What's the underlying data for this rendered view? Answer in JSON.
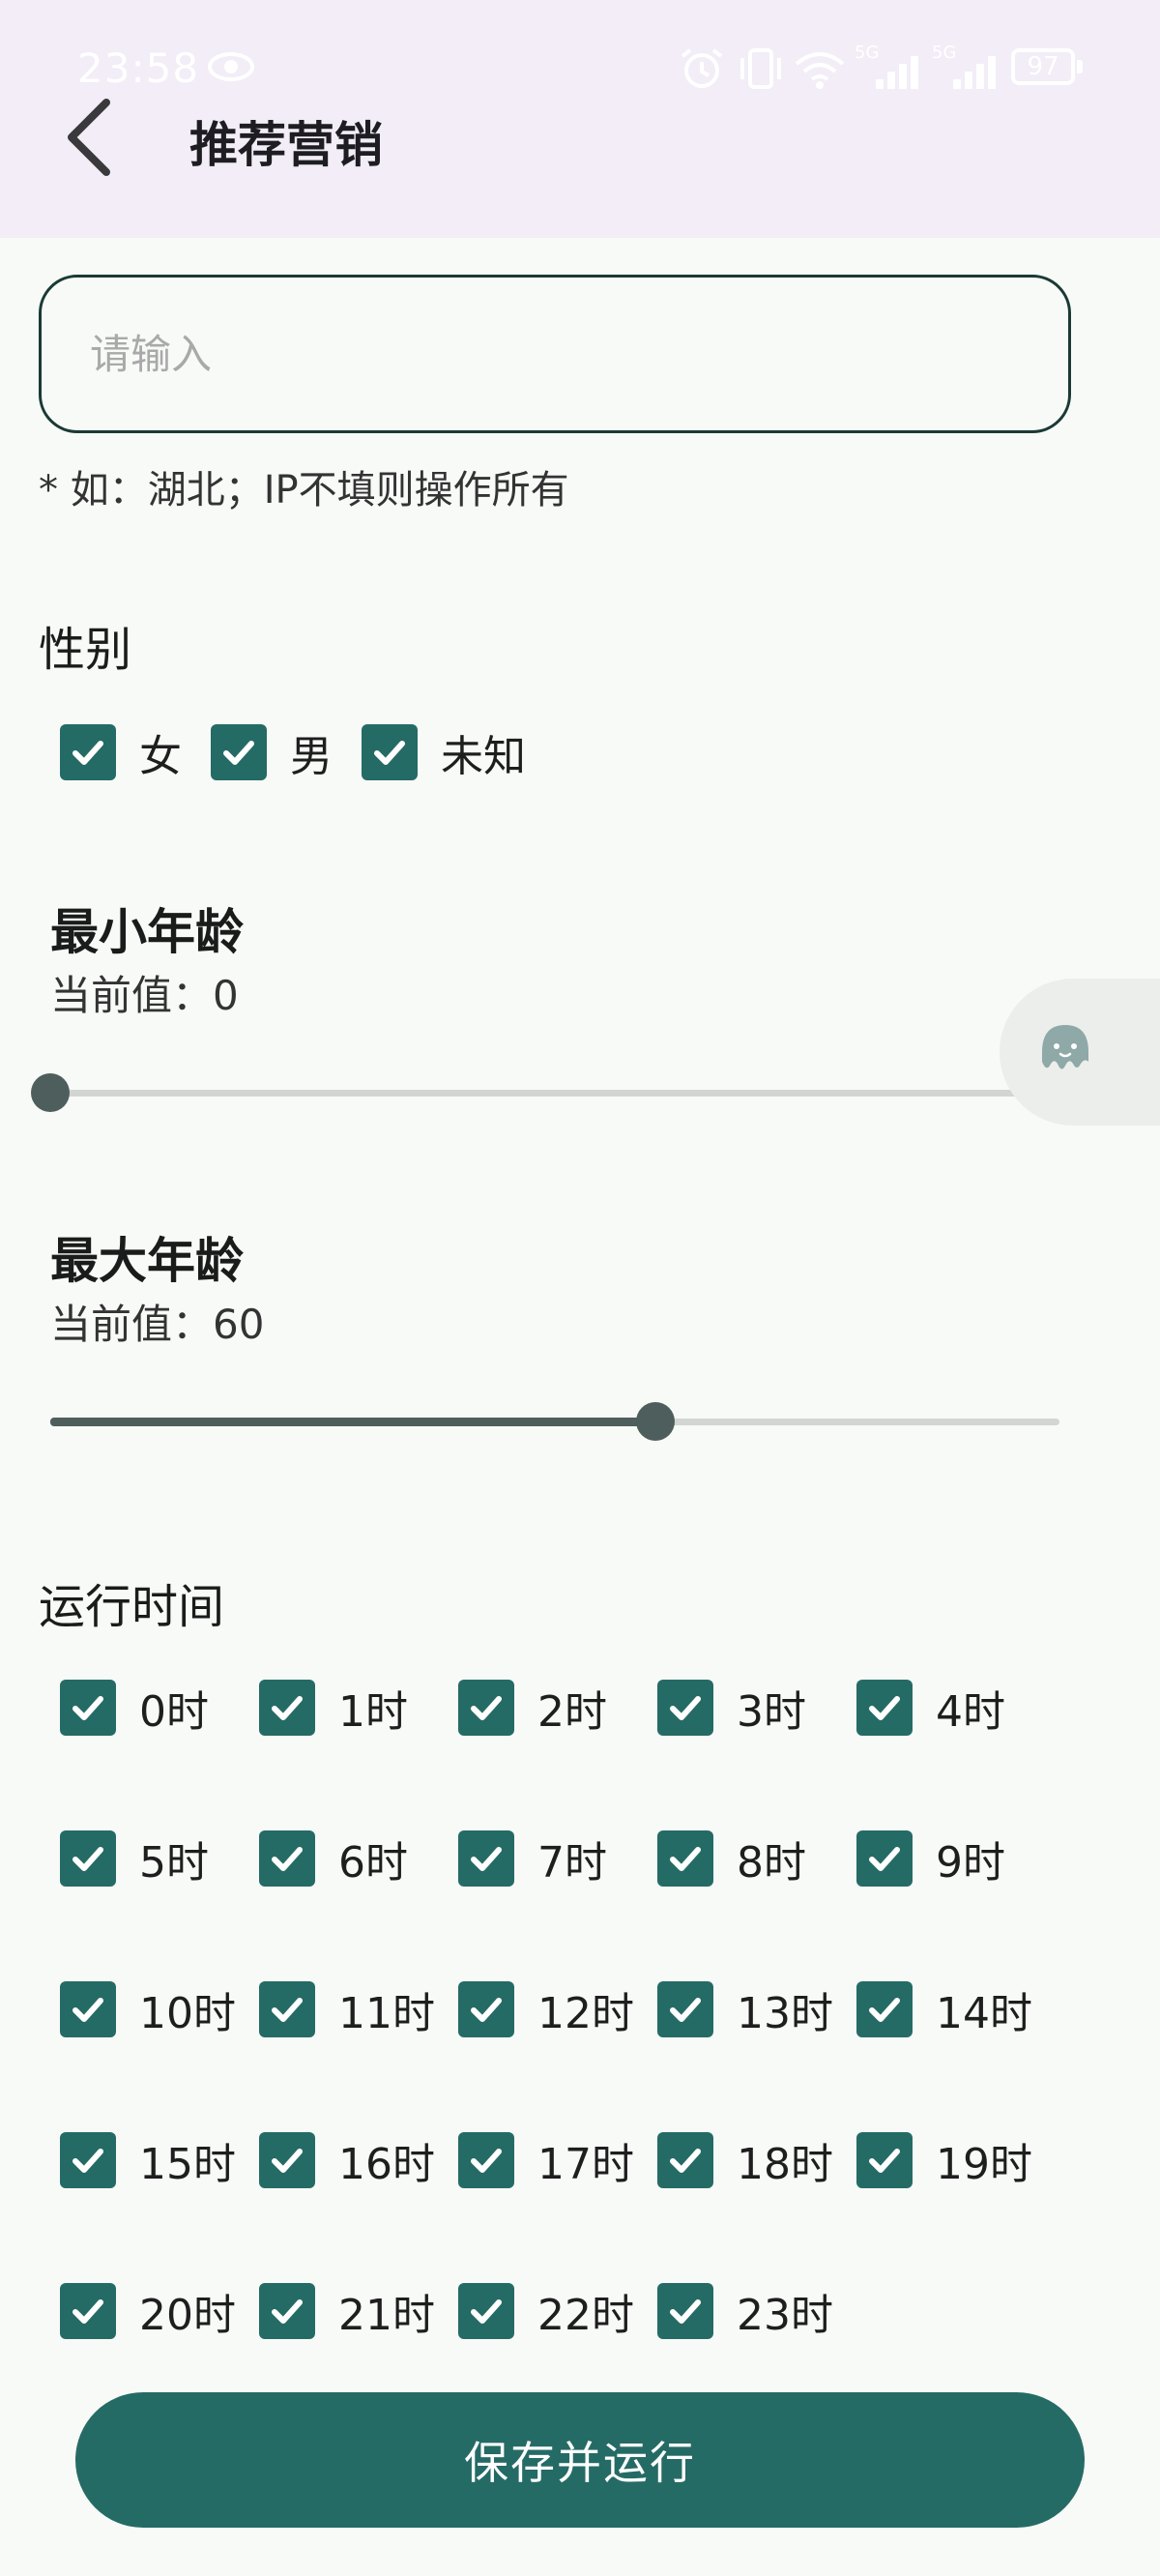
{
  "status_bar": {
    "time": "23:58",
    "battery": "97",
    "network_1": "5G",
    "network_2": "5G"
  },
  "header": {
    "title": "推荐营销"
  },
  "ip_field": {
    "placeholder": "请输入",
    "value": "",
    "hint": "* 如：湖北；IP不填则操作所有"
  },
  "gender": {
    "title": "性别",
    "options": [
      {
        "label": "女",
        "checked": true
      },
      {
        "label": "男",
        "checked": true
      },
      {
        "label": "未知",
        "checked": true
      }
    ]
  },
  "min_age": {
    "title": "最小年龄",
    "current": "当前值：0",
    "value": 0,
    "max": 100
  },
  "max_age": {
    "title": "最大年龄",
    "current": "当前值：60",
    "value": 60,
    "max": 100
  },
  "run_time": {
    "title": "运行时间",
    "hours": [
      {
        "label": "0时",
        "checked": true
      },
      {
        "label": "1时",
        "checked": true
      },
      {
        "label": "2时",
        "checked": true
      },
      {
        "label": "3时",
        "checked": true
      },
      {
        "label": "4时",
        "checked": true
      },
      {
        "label": "5时",
        "checked": true
      },
      {
        "label": "6时",
        "checked": true
      },
      {
        "label": "7时",
        "checked": true
      },
      {
        "label": "8时",
        "checked": true
      },
      {
        "label": "9时",
        "checked": true
      },
      {
        "label": "10时",
        "checked": true
      },
      {
        "label": "11时",
        "checked": true
      },
      {
        "label": "12时",
        "checked": true
      },
      {
        "label": "13时",
        "checked": true
      },
      {
        "label": "14时",
        "checked": true
      },
      {
        "label": "15时",
        "checked": true
      },
      {
        "label": "16时",
        "checked": true
      },
      {
        "label": "17时",
        "checked": true
      },
      {
        "label": "18时",
        "checked": true
      },
      {
        "label": "19时",
        "checked": true
      },
      {
        "label": "20时",
        "checked": true
      },
      {
        "label": "21时",
        "checked": true
      },
      {
        "label": "22时",
        "checked": true
      },
      {
        "label": "23时",
        "checked": true
      }
    ]
  },
  "actions": {
    "save_label": "保存并运行"
  },
  "colors": {
    "accent": "#256b65",
    "header_bg": "#f2edf6",
    "page_bg": "#f8faf8",
    "slider_active": "#4e5e5c"
  }
}
